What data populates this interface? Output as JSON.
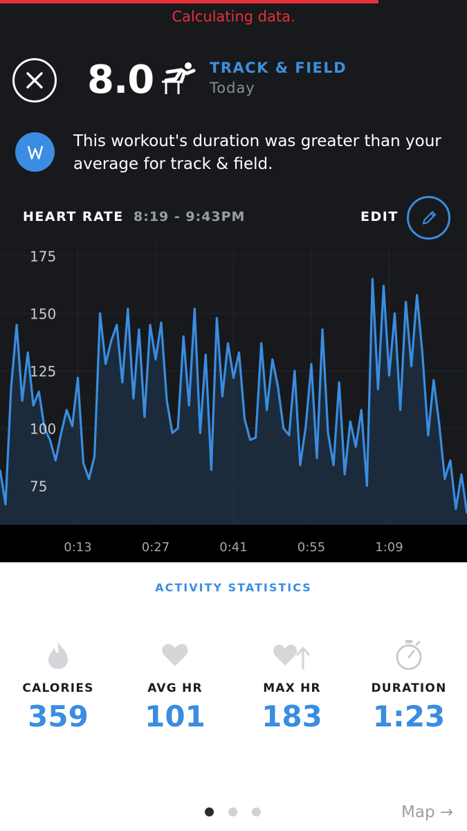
{
  "status_text": "Calculating data.",
  "header": {
    "score": "8.0",
    "activity_name": "TRACK & FIELD",
    "activity_date": "Today",
    "activity_icon": "hurdle-runner-icon"
  },
  "insight": {
    "icon": "whoop-logo-icon",
    "text": "This workout's duration was greater than your average for track & field."
  },
  "heart_rate": {
    "title": "HEART RATE",
    "time_range": "8:19 - 9:43PM",
    "edit_label": "EDIT"
  },
  "chart_data": {
    "type": "line",
    "title": "HEART RATE",
    "ylim": [
      58,
      180
    ],
    "yticks": [
      "175",
      "150",
      "125",
      "100",
      "75"
    ],
    "xlim": [
      0,
      84
    ],
    "xticks": [
      "0:13",
      "0:27",
      "0:41",
      "0:55",
      "1:09"
    ],
    "xtick_positions": [
      14,
      28,
      42,
      56,
      70
    ],
    "grid": true,
    "series": [
      {
        "color": "#3a8de0",
        "x": [
          0,
          1,
          2,
          3,
          4,
          5,
          6,
          7,
          8,
          9,
          10,
          11,
          12,
          13,
          14,
          15,
          16,
          17,
          18,
          19,
          20,
          21,
          22,
          23,
          24,
          25,
          26,
          27,
          28,
          29,
          30,
          31,
          32,
          33,
          34,
          35,
          36,
          37,
          38,
          39,
          40,
          41,
          42,
          43,
          44,
          45,
          46,
          47,
          48,
          49,
          50,
          51,
          52,
          53,
          54,
          55,
          56,
          57,
          58,
          59,
          60,
          61,
          62,
          63,
          64,
          65,
          66,
          67,
          68,
          69,
          70,
          71,
          72,
          73,
          74,
          75,
          76,
          77,
          78,
          79,
          80,
          81,
          82,
          83,
          84
        ],
        "values": [
          82,
          67,
          118,
          145,
          112,
          133,
          110,
          116,
          100,
          95,
          86,
          98,
          108,
          101,
          122,
          85,
          78,
          88,
          150,
          128,
          138,
          145,
          120,
          152,
          113,
          143,
          105,
          145,
          130,
          146,
          112,
          98,
          100,
          140,
          110,
          152,
          98,
          132,
          82,
          148,
          114,
          137,
          122,
          133,
          104,
          95,
          96,
          137,
          108,
          130,
          118,
          100,
          97,
          125,
          84,
          101,
          128,
          87,
          143,
          98,
          84,
          120,
          80,
          103,
          92,
          108,
          75,
          165,
          117,
          162,
          123,
          150,
          108,
          155,
          127,
          158,
          132,
          97,
          121,
          102,
          78,
          86,
          65,
          80,
          63
        ]
      }
    ]
  },
  "activity_statistics": {
    "title": "ACTIVITY STATISTICS",
    "items": [
      {
        "label": "CALORIES",
        "value": "359",
        "icon": "flame-icon"
      },
      {
        "label": "AVG HR",
        "value": "101",
        "icon": "heart-icon"
      },
      {
        "label": "MAX HR",
        "value": "183",
        "icon": "heart-up-arrow-icon"
      },
      {
        "label": "DURATION",
        "value": "1:23",
        "icon": "stopwatch-icon"
      }
    ]
  },
  "pager": {
    "pages": 3,
    "current": 0
  },
  "map_link": "Map →"
}
